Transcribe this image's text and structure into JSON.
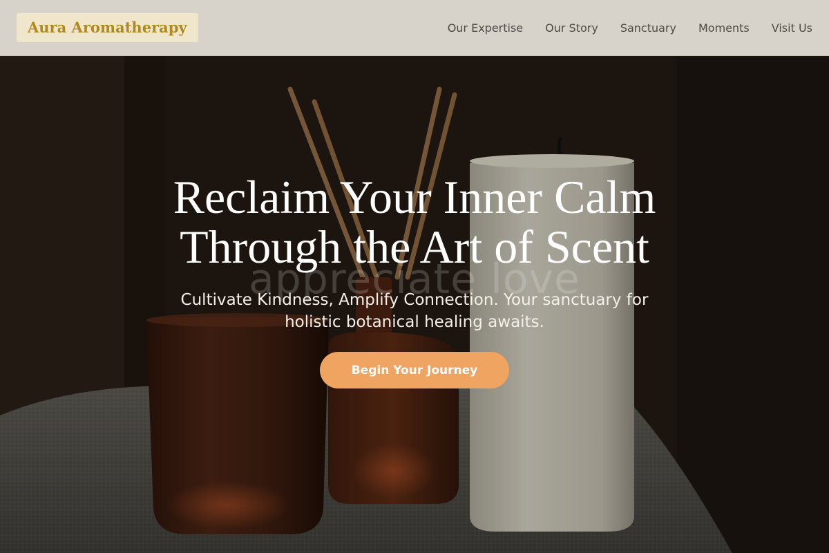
{
  "header": {
    "logo": "Aura Aromatherapy",
    "nav": [
      {
        "label": "Our Expertise"
      },
      {
        "label": "Our Story"
      },
      {
        "label": "Sanctuary"
      },
      {
        "label": "Moments"
      },
      {
        "label": "Visit Us"
      }
    ]
  },
  "hero": {
    "title": "Reclaim Your Inner Calm Through the Art of Scent",
    "subtitle": "Cultivate Kindness, Amplify Connection. Your sanctuary for holistic botanical healing awaits.",
    "watermark": "appreciate love",
    "cta_label": "Begin Your Journey"
  },
  "colors": {
    "header_bg": "#d8d3ca",
    "logo_bg": "#efe6cc",
    "logo_text": "#b08a1e",
    "nav_text": "#4e4a44",
    "cta_bg": "#f0a462",
    "hero_text": "#ffffff"
  }
}
